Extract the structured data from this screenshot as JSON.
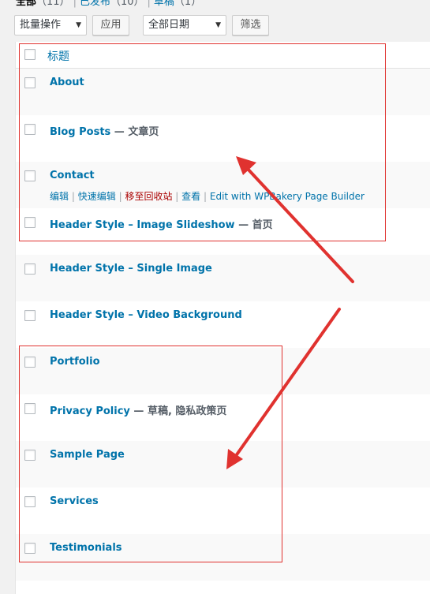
{
  "filters": {
    "all": "全部",
    "all_count": "（11）",
    "published": "已发布",
    "published_count": "（10）",
    "draft": "草稿",
    "draft_count": "（1）",
    "separator": "|"
  },
  "toolbar": {
    "bulk_action": "批量操作",
    "apply": "应用",
    "date_filter": "全部日期",
    "filter": "筛选"
  },
  "table": {
    "column_title": "标题",
    "rows": [
      {
        "title": "About",
        "state": ""
      },
      {
        "title": "Blog Posts",
        "state": " — 文章页"
      },
      {
        "title": "Contact",
        "state": ""
      },
      {
        "title": "Header Style – Image Slideshow",
        "state": " — 首页"
      },
      {
        "title": "Header Style – Single Image",
        "state": ""
      },
      {
        "title": "Header Style – Video Background",
        "state": ""
      },
      {
        "title": "Portfolio",
        "state": ""
      },
      {
        "title": "Privacy Policy",
        "state": " — 草稿, 隐私政策页"
      },
      {
        "title": "Sample Page",
        "state": ""
      },
      {
        "title": "Services",
        "state": ""
      },
      {
        "title": "Testimonials",
        "state": ""
      }
    ],
    "row_actions": {
      "edit": "编辑",
      "quick_edit": "快速编辑",
      "trash": "移至回收站",
      "view": "查看",
      "builder": "Edit with WPBakery Page Builder",
      "separator": "|"
    }
  },
  "colors": {
    "link": "#0073aa",
    "trash": "#aa0000",
    "annotation": "#e0322f"
  }
}
